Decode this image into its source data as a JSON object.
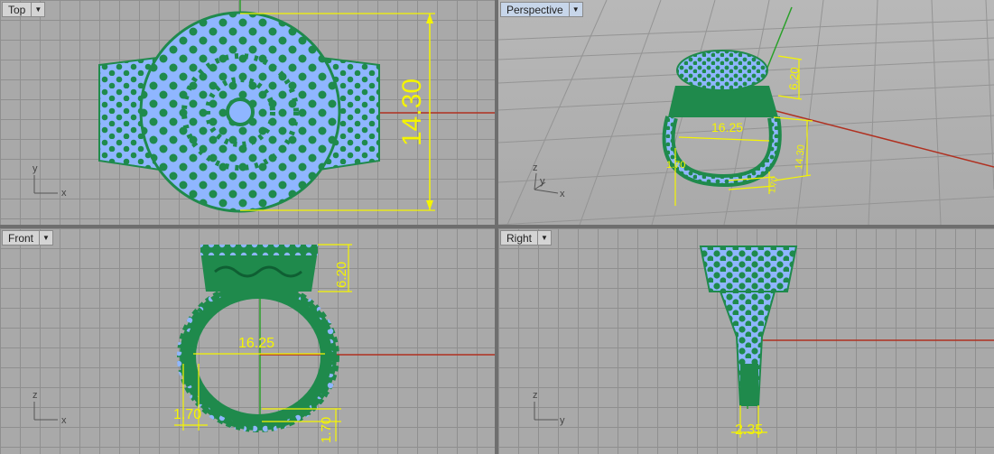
{
  "viewports": {
    "top": {
      "label": "Top",
      "dimension_label": "14.30",
      "axis_vertical": "y",
      "axis_horizontal": "x"
    },
    "perspective": {
      "label": "Perspective",
      "dimension_labels": [
        "6.20",
        "16.25",
        "14.30",
        "1.70",
        "1.70"
      ],
      "axis_vertical": "z",
      "axis_y": "y",
      "axis_horizontal": "x"
    },
    "front": {
      "label": "Front",
      "dimension_labels": [
        "6.20",
        "16.25",
        "1.70",
        "1.70"
      ],
      "axis_vertical": "z",
      "axis_horizontal": "x"
    },
    "right": {
      "label": "Right",
      "dimension_label": "2.35",
      "axis_vertical": "z",
      "axis_horizontal": "y"
    }
  },
  "colors": {
    "viewport_bg": "#a9a9a9",
    "grid": "#8f8f8f",
    "metal": "#1f8a4c",
    "gem": "#8fb6ff",
    "dimension": "#f5f500",
    "x_axis": "#b03020",
    "y_axis": "#2aa02a"
  },
  "icons": [
    "dropdown-arrow-icon",
    "axis-gizmo-icon"
  ]
}
